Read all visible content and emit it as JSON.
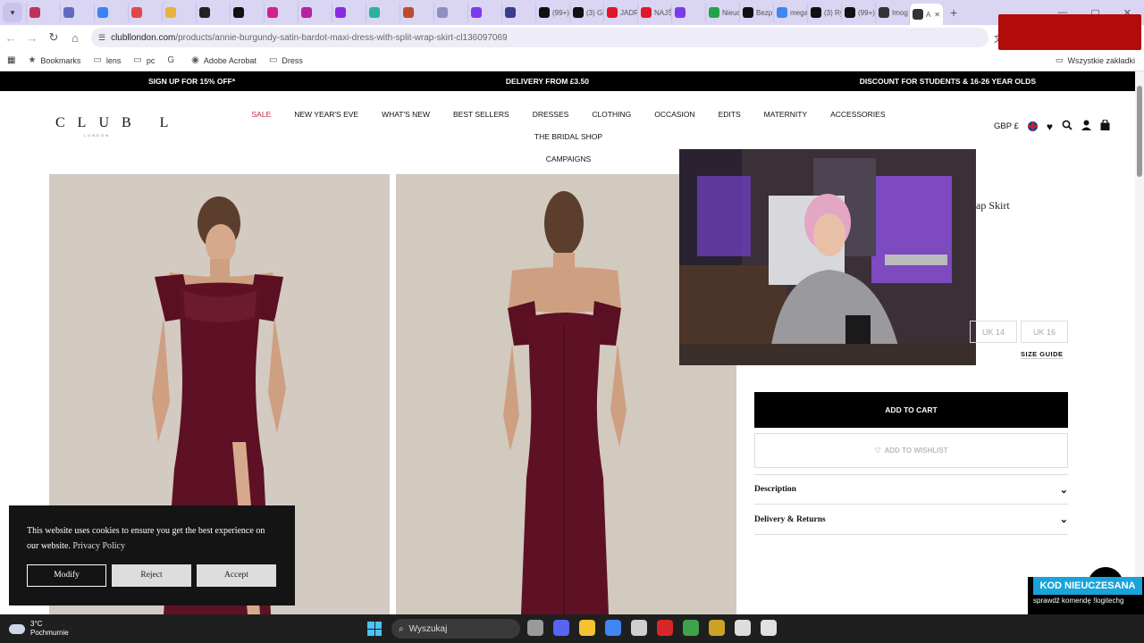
{
  "browser": {
    "tab_menu_icon": "chevron-down-icon",
    "tabs": [
      {
        "label": "",
        "color": "#c0325a"
      },
      {
        "label": "",
        "color": "#5f6abf"
      },
      {
        "label": "",
        "color": "#3b82f6"
      },
      {
        "label": "",
        "color": "#e04848"
      },
      {
        "label": "",
        "color": "#e8b23a"
      },
      {
        "label": "",
        "color": "#222222"
      },
      {
        "label": "",
        "color": "#111111"
      },
      {
        "label": "",
        "color": "#d2228a"
      },
      {
        "label": "",
        "color": "#b5239e"
      },
      {
        "label": "",
        "color": "#8a2be2"
      },
      {
        "label": "",
        "color": "#2bb3a0"
      },
      {
        "label": "",
        "color": "#c04a2b"
      },
      {
        "label": "",
        "color": "#9090c0"
      },
      {
        "label": "",
        "color": "#7c3aed"
      },
      {
        "label": "",
        "color": "#3a3a90"
      },
      {
        "label": "(99+)",
        "color": "#111111"
      },
      {
        "label": "(3) Gi",
        "color": "#111111"
      },
      {
        "label": "JADR",
        "color": "#e0162b"
      },
      {
        "label": "NAJŚ",
        "color": "#e0162b"
      },
      {
        "label": "",
        "color": "#7c3aed"
      },
      {
        "label": "Nieuc",
        "color": "#22a34a"
      },
      {
        "label": "Bezp",
        "color": "#111111"
      },
      {
        "label": "mega",
        "color": "#4285f4"
      },
      {
        "label": "(3) Ry",
        "color": "#111111"
      },
      {
        "label": "(99+)",
        "color": "#111111"
      },
      {
        "label": "Imog",
        "color": "#333333"
      },
      {
        "label": "A",
        "color": "#333333"
      }
    ],
    "url_host": "clubllondon.com",
    "url_path": "/products/annie-burgundy-satin-bardot-maxi-dress-with-split-wrap-skirt-cl136097069",
    "bookmarks": [
      {
        "label": "Bookmarks",
        "icon": "star-icon"
      },
      {
        "label": "lens",
        "icon": "folder-icon"
      },
      {
        "label": "pc",
        "icon": "folder-icon"
      },
      {
        "label": "",
        "icon": "google-icon"
      },
      {
        "label": "Adobe Acrobat",
        "icon": "acrobat-icon"
      },
      {
        "label": "Dress",
        "icon": "folder-icon"
      }
    ],
    "all_bookmarks": "Wszystkie zakładki"
  },
  "promo": {
    "left": "SIGN UP FOR 15% OFF*",
    "center": "DELIVERY FROM £3.50",
    "right": "DISCOUNT FOR STUDENTS & 16-26 YEAR OLDS"
  },
  "header": {
    "logo": "CLUB L",
    "logo_sub": "LONDON",
    "nav": [
      "SALE",
      "NEW YEAR'S EVE",
      "WHAT'S NEW",
      "BEST SELLERS",
      "DRESSES",
      "CLOTHING",
      "OCCASION",
      "EDITS",
      "MATERNITY",
      "ACCESSORIES",
      "THE BRIDAL SHOP",
      "CAMPAIGNS"
    ],
    "currency": "GBP £"
  },
  "product": {
    "title_fragment": "ap Skirt",
    "sizes": [
      "UK 14",
      "UK 16"
    ],
    "size_guide": "SIZE GUIDE",
    "add_to_cart": "ADD TO CART",
    "add_to_wishlist": "ADD TO WISHLIST",
    "accordions": [
      "Description",
      "Delivery & Returns"
    ]
  },
  "cookie": {
    "text": "This website uses cookies to ensure you get the best experience on our website.",
    "policy_link": "Privacy Policy",
    "modify": "Modify",
    "reject": "Reject",
    "accept": "Accept"
  },
  "stream_badge": {
    "title": "KOD NIEUCZESANA",
    "subtitle": "sprawdź komendę !logitechg"
  },
  "taskbar": {
    "temperature": "3°C",
    "condition": "Pochmurnie",
    "search_placeholder": "Wyszukaj",
    "app_colors": [
      "#9a9a9a",
      "#5865f2",
      "#f4c430",
      "#4285f4",
      "#cfcfcf",
      "#d62828",
      "#3fa34d",
      "#c9a227",
      "#dddddd",
      "#e0e0e0"
    ]
  },
  "colors": {
    "sale": "#c4283f",
    "dress": "#5a0f22",
    "photo_bg": "#d2c9c0"
  }
}
